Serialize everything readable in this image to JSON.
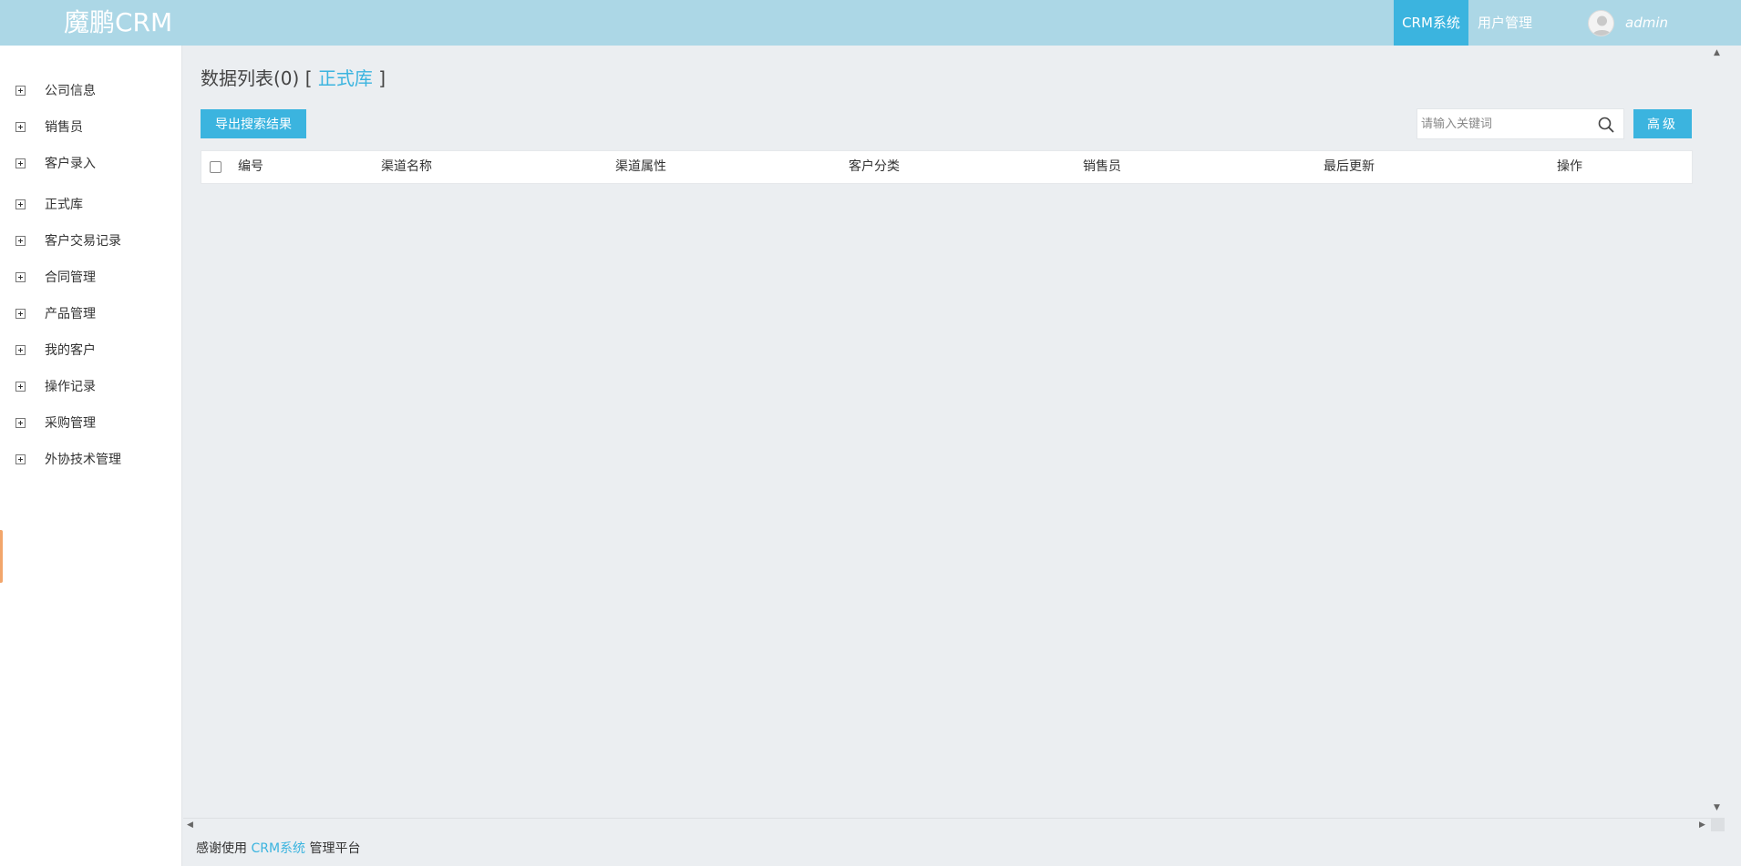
{
  "header": {
    "logo": "魔鹏CRM",
    "nav": [
      {
        "label": "CRM系统",
        "active": true
      },
      {
        "label": "用户管理",
        "active": false
      }
    ],
    "user": "admin"
  },
  "sidebar": {
    "items": [
      {
        "label": "公司信息"
      },
      {
        "label": "销售员"
      },
      {
        "label": "客户录入"
      },
      {
        "label": "正式库"
      },
      {
        "label": "客户交易记录"
      },
      {
        "label": "合同管理"
      },
      {
        "label": "产品管理"
      },
      {
        "label": "我的客户"
      },
      {
        "label": "操作记录"
      },
      {
        "label": "采购管理"
      },
      {
        "label": "外协技术管理"
      }
    ]
  },
  "main": {
    "title": "数据列表(0)",
    "bracket_open": "[",
    "crumb": "正式库",
    "bracket_close": "]",
    "export_button": "导出搜索结果",
    "search_placeholder": "请输入关键词",
    "advanced_button": "高级",
    "table": {
      "columns": [
        "编号",
        "渠道名称",
        "渠道属性",
        "客户分类",
        "销售员",
        "最后更新",
        "操作"
      ],
      "rows": []
    }
  },
  "footer": {
    "prefix": "感谢使用",
    "brand": "CRM系统",
    "suffix": "管理平台"
  },
  "colors": {
    "topbar": "#acd7e6",
    "accent": "#3bb4df",
    "background": "#ebeef1"
  }
}
